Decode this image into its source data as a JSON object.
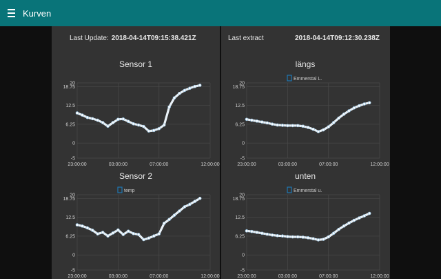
{
  "toolbar": {
    "title": "Kurven",
    "menu_icon": "hamburger-menu-icon",
    "color": "#097479"
  },
  "left_panel": {
    "label": "Last Update:",
    "value": "2018-04-14T09:15:38.421Z"
  },
  "right_panel": {
    "label": "Last extract",
    "value": "2018-04-14T09:12:30.238Z"
  },
  "chart_data": [
    {
      "type": "line",
      "title": "Sensor 1",
      "legend": [],
      "xlim": [
        0,
        13
      ],
      "ylim": [
        -5,
        20
      ],
      "xticks": [
        {
          "v": 0,
          "label": "23:00:00"
        },
        {
          "v": 4,
          "label": "03:00:00"
        },
        {
          "v": 8,
          "label": "07:00:00"
        },
        {
          "v": 13,
          "label": "12:00:00"
        }
      ],
      "yticks": [
        {
          "v": -5,
          "label": "-5"
        },
        {
          "v": 0,
          "label": "0"
        },
        {
          "v": 6.25,
          "label": "6.25"
        },
        {
          "v": 12.5,
          "label": "12.5"
        },
        {
          "v": 18.75,
          "label": "18.75"
        },
        {
          "v": 20,
          "label": "20"
        }
      ],
      "x": [
        0,
        0.5,
        1,
        1.5,
        2,
        2.5,
        3,
        3.5,
        4,
        4.5,
        5,
        5.5,
        6,
        6.5,
        7,
        7.5,
        8,
        8.5,
        9,
        9.5,
        10,
        10.5,
        11,
        11.5,
        12
      ],
      "values": [
        10,
        9.3,
        8.5,
        8.1,
        7.6,
        6.8,
        5.6,
        6.8,
        7.9,
        8.0,
        7.2,
        6.4,
        6.0,
        5.5,
        4.0,
        4.2,
        4.8,
        6.0,
        12.0,
        15.0,
        16.5,
        17.5,
        18.2,
        18.8,
        19.2
      ]
    },
    {
      "type": "line",
      "title": "längs",
      "legend": [
        "Emmerstal L."
      ],
      "xlim": [
        0,
        13
      ],
      "ylim": [
        -5,
        20
      ],
      "xticks": [
        {
          "v": 0,
          "label": "23:00:00"
        },
        {
          "v": 4,
          "label": "03:00:00"
        },
        {
          "v": 8,
          "label": "07:00:00"
        },
        {
          "v": 13,
          "label": "12:00:00"
        }
      ],
      "yticks": [
        {
          "v": -5,
          "label": "-5"
        },
        {
          "v": 0,
          "label": "0"
        },
        {
          "v": 6.25,
          "label": "6.25"
        },
        {
          "v": 12.5,
          "label": "12.5"
        },
        {
          "v": 18.75,
          "label": "18.75"
        },
        {
          "v": 20,
          "label": "20"
        }
      ],
      "x": [
        0,
        0.5,
        1,
        1.5,
        2,
        2.5,
        3,
        3.5,
        4,
        4.5,
        5,
        5.5,
        6,
        6.5,
        7,
        7.5,
        8,
        8.5,
        9,
        9.5,
        10,
        10.5,
        11,
        11.5,
        12
      ],
      "values": [
        7.9,
        7.6,
        7.3,
        7.0,
        6.7,
        6.3,
        6.0,
        5.9,
        5.8,
        5.8,
        5.8,
        5.6,
        5.2,
        4.6,
        3.8,
        4.4,
        5.4,
        6.8,
        8.3,
        9.6,
        10.7,
        11.7,
        12.4,
        13.0,
        13.4
      ]
    },
    {
      "type": "line",
      "title": "Sensor 2",
      "legend": [
        "temp"
      ],
      "xlim": [
        0,
        13
      ],
      "ylim": [
        -5,
        20
      ],
      "xticks": [
        {
          "v": 0,
          "label": "23:00:00"
        },
        {
          "v": 4,
          "label": "03:00:00"
        },
        {
          "v": 8,
          "label": "07:00:00"
        },
        {
          "v": 13,
          "label": "12:00:00"
        }
      ],
      "yticks": [
        {
          "v": -5,
          "label": "-5"
        },
        {
          "v": 0,
          "label": "0"
        },
        {
          "v": 6.25,
          "label": "6.25"
        },
        {
          "v": 12.5,
          "label": "12.5"
        },
        {
          "v": 18.75,
          "label": "18.75"
        },
        {
          "v": 20,
          "label": "20"
        }
      ],
      "x": [
        0,
        0.5,
        1,
        1.5,
        2,
        2.5,
        3,
        3.5,
        4,
        4.5,
        5,
        5.5,
        6,
        6.5,
        7,
        7.5,
        8,
        8.5,
        9,
        9.5,
        10,
        10.5,
        11,
        11.5,
        12
      ],
      "values": [
        10,
        9.6,
        9.0,
        8.2,
        7.0,
        7.5,
        6.3,
        7.3,
        8.3,
        6.8,
        7.9,
        7.1,
        6.8,
        5.1,
        5.6,
        6.3,
        7.0,
        10.5,
        11.8,
        13.2,
        14.6,
        16.0,
        16.8,
        17.8,
        18.8
      ]
    },
    {
      "type": "line",
      "title": "unten",
      "legend": [
        "Emmerstal u."
      ],
      "xlim": [
        0,
        13
      ],
      "ylim": [
        -5,
        20
      ],
      "xticks": [
        {
          "v": 0,
          "label": "23:00:00"
        },
        {
          "v": 4,
          "label": "03:00:00"
        },
        {
          "v": 8,
          "label": "07:00:00"
        },
        {
          "v": 13,
          "label": "12:00:00"
        }
      ],
      "yticks": [
        {
          "v": -5,
          "label": "-5"
        },
        {
          "v": 0,
          "label": "0"
        },
        {
          "v": 6.25,
          "label": "6.25"
        },
        {
          "v": 12.5,
          "label": "12.5"
        },
        {
          "v": 18.75,
          "label": "18.75"
        },
        {
          "v": 20,
          "label": "20"
        }
      ],
      "x": [
        0,
        0.5,
        1,
        1.5,
        2,
        2.5,
        3,
        3.5,
        4,
        4.5,
        5,
        5.5,
        6,
        6.5,
        7,
        7.5,
        8,
        8.5,
        9,
        9.5,
        10,
        10.5,
        11,
        11.5,
        12
      ],
      "values": [
        8.0,
        7.8,
        7.5,
        7.2,
        6.9,
        6.6,
        6.4,
        6.3,
        6.1,
        6.0,
        6.0,
        5.9,
        5.7,
        5.4,
        5.0,
        5.2,
        6.0,
        7.2,
        8.5,
        9.6,
        10.6,
        11.5,
        12.3,
        13.0,
        13.8
      ]
    }
  ]
}
